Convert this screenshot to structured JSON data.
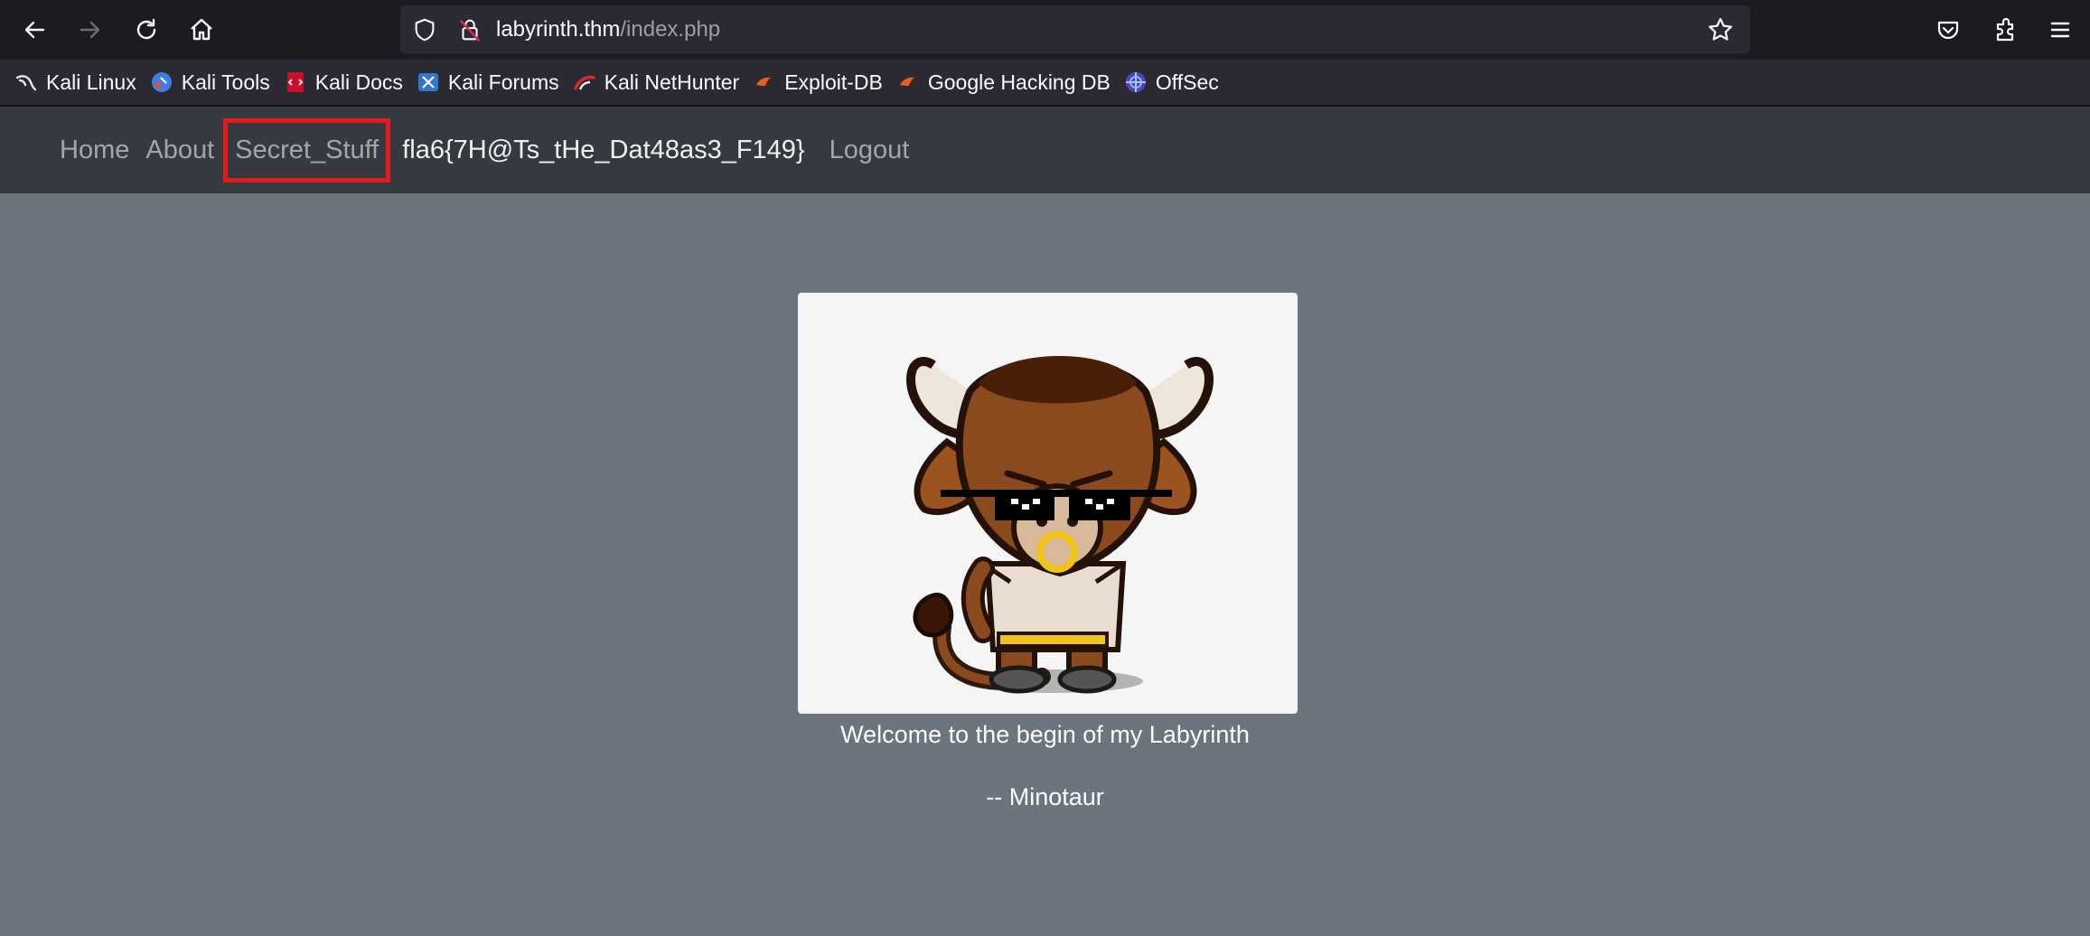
{
  "browser": {
    "url_host": "labyrinth.thm",
    "url_path": "/index.php",
    "toolbar_icons": [
      "back-icon",
      "forward-icon",
      "reload-icon",
      "home-icon",
      "shield-icon",
      "lock-icon",
      "bookmark-star-icon",
      "pocket-icon",
      "extensions-icon",
      "menu-icon"
    ],
    "bookmarks": [
      {
        "label": "Kali Linux",
        "icon": "kali-dragon-icon"
      },
      {
        "label": "Kali Tools",
        "icon": "kali-tools-icon"
      },
      {
        "label": "Kali Docs",
        "icon": "kali-docs-icon"
      },
      {
        "label": "Kali Forums",
        "icon": "kali-forums-icon"
      },
      {
        "label": "Kali NetHunter",
        "icon": "kali-nethunter-icon"
      },
      {
        "label": "Exploit-DB",
        "icon": "exploit-db-icon"
      },
      {
        "label": "Google Hacking DB",
        "icon": "ghdb-icon"
      },
      {
        "label": "OffSec",
        "icon": "offsec-icon"
      }
    ]
  },
  "nav": {
    "home": "Home",
    "about": "About",
    "secret": "Secret_Stuff",
    "flag": "fla6{7H@Ts_tHe_Dat48as3_F149}",
    "logout": "Logout"
  },
  "content": {
    "image_alt_icon": "minotaur-mascot-image",
    "welcome": "Welcome to the begin of my Labyrinth",
    "signature": "-- Minotaur"
  },
  "colors": {
    "page_bg": "#6c757d",
    "navbar_bg": "#343a40",
    "highlight": "#e11b1b"
  }
}
